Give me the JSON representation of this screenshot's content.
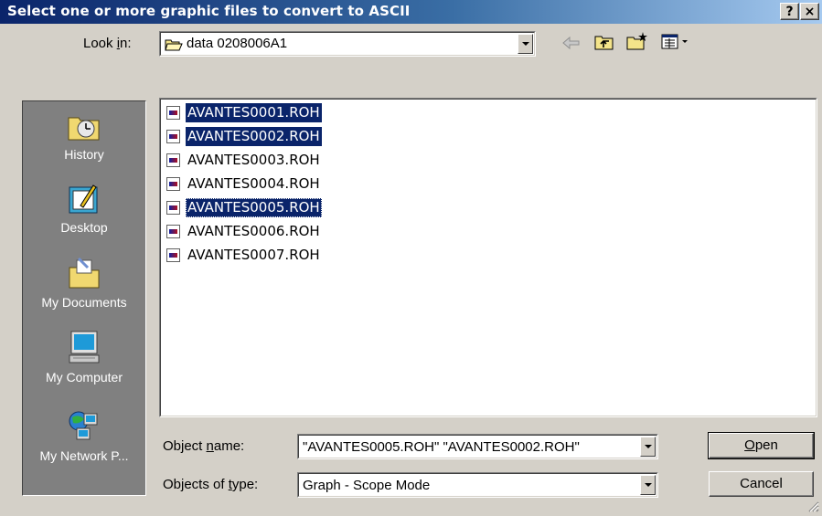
{
  "window": {
    "title": "Select one or more graphic files to convert to ASCII",
    "help_button": "?",
    "close_button": "×"
  },
  "lookin": {
    "label_pre": "Look ",
    "label_u": "i",
    "label_post": "n:",
    "value": "data 0208006A1"
  },
  "places": [
    {
      "label": "History",
      "icon": "history-icon"
    },
    {
      "label": "Desktop",
      "icon": "desktop-icon"
    },
    {
      "label": "My Documents",
      "icon": "my-documents-icon"
    },
    {
      "label": "My Computer",
      "icon": "my-computer-icon"
    },
    {
      "label": "My Network P...",
      "icon": "network-places-icon"
    }
  ],
  "files": [
    {
      "name": "AVANTES0001.ROH",
      "selected": true,
      "focus": false
    },
    {
      "name": "AVANTES0002.ROH",
      "selected": true,
      "focus": false
    },
    {
      "name": "AVANTES0003.ROH",
      "selected": false,
      "focus": false
    },
    {
      "name": "AVANTES0004.ROH",
      "selected": false,
      "focus": false
    },
    {
      "name": "AVANTES0005.ROH",
      "selected": true,
      "focus": true
    },
    {
      "name": "AVANTES0006.ROH",
      "selected": false,
      "focus": false
    },
    {
      "name": "AVANTES0007.ROH",
      "selected": false,
      "focus": false
    }
  ],
  "object_name": {
    "label_pre": "Object ",
    "label_u": "n",
    "label_post": "ame:",
    "value": "\"AVANTES0005.ROH\" \"AVANTES0002.ROH\""
  },
  "object_type": {
    "label_pre": "Objects of ",
    "label_u": "t",
    "label_post": "ype:",
    "value": "Graph - Scope Mode"
  },
  "buttons": {
    "open_u": "O",
    "open_rest": "pen",
    "cancel": "Cancel"
  }
}
